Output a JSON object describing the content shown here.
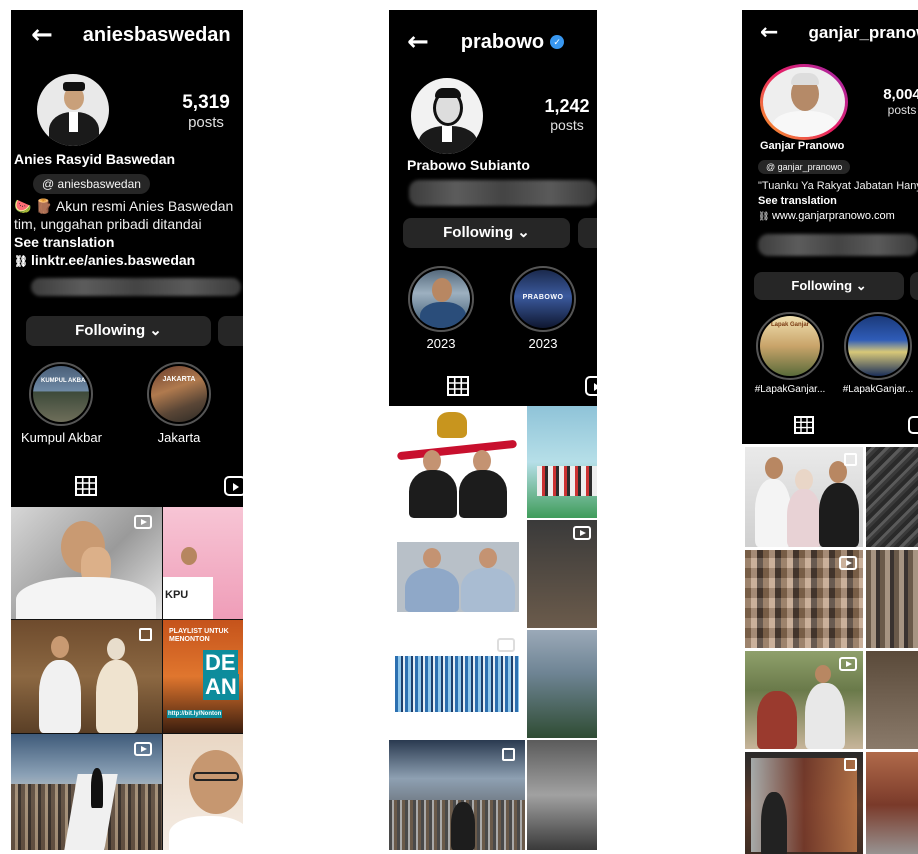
{
  "profiles": [
    {
      "username": "aniesbaswedan",
      "posts_count": "5,319",
      "posts_label": "posts",
      "full_name": "Anies Rasyid Baswedan",
      "threads_handle": "aniesbaswedan",
      "bio_line1": "🍉 🪵 Akun resmi Anies Baswedan",
      "bio_line2": "tim, unggahan pribadi ditandai",
      "see_translation": "See translation",
      "link": "linktr.ee/anies.baswedan",
      "following_label": "Following",
      "highlights": [
        {
          "caption": "Kumpul Akbar",
          "badge": "KUMPUL AKBAR"
        },
        {
          "caption": "Jakarta",
          "badge": "JAKARTA"
        }
      ],
      "post_texts": {
        "kpu": "KPU",
        "playlist": "PLAYLIST UNTUK MENONTON",
        "de": "DE",
        "an": "AN",
        "url": "http://bit.ly/Nonton"
      }
    },
    {
      "username": "prabowo",
      "posts_count": "1,242",
      "posts_label": "posts",
      "full_name": "Prabowo Subianto",
      "following_label": "Following",
      "highlights": [
        {
          "caption": "2023",
          "badge": ""
        },
        {
          "caption": "2023",
          "badge": "PRABOWO"
        }
      ]
    },
    {
      "username": "ganjar_pranowo",
      "posts_count": "8,004",
      "posts_label": "posts",
      "full_name": "Ganjar Pranowo",
      "threads_handle": "ganjar_pranowo",
      "bio_line1": "\"Tuanku Ya Rakyat Jabatan Hanya Mandat\"",
      "see_translation": "See translation",
      "link": "www.ganjarpranowo.com",
      "following_label": "Following",
      "highlights": [
        {
          "caption": "#LapakGanjar...",
          "badge": "Lapak Ganjar"
        },
        {
          "caption": "#LapakGanjar...",
          "badge": ""
        }
      ]
    }
  ],
  "icons": {
    "back": "←",
    "chevron": "⌄",
    "threads": "@",
    "link": "🔗",
    "verified": "✓"
  }
}
